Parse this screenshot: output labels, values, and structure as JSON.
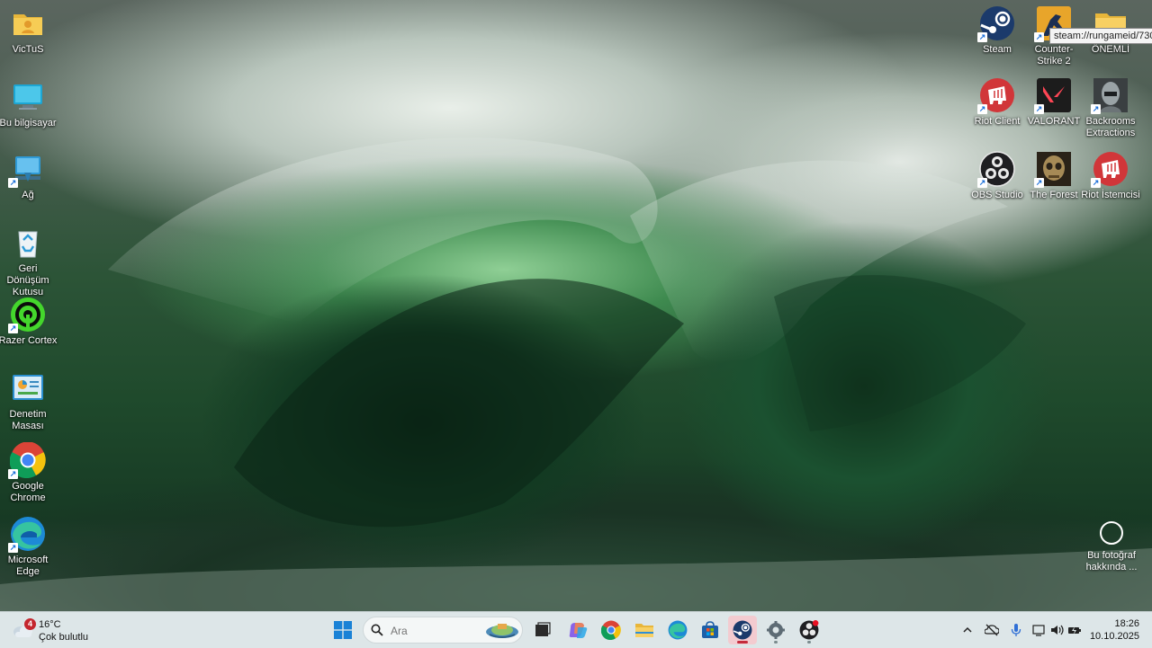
{
  "desktop": {
    "left_icons": [
      {
        "label": "VicTuS",
        "icon": "user-folder-icon"
      },
      {
        "label": "Bu bilgisayar",
        "icon": "monitor-icon"
      },
      {
        "label": "Ağ",
        "icon": "network-icon"
      },
      {
        "label": "Geri Dönüşüm Kutusu",
        "icon": "recycle-bin-icon"
      },
      {
        "label": "Razer Cortex",
        "icon": "razer-cortex-icon"
      },
      {
        "label": "Denetim Masası",
        "icon": "control-panel-icon"
      },
      {
        "label": "Google Chrome",
        "icon": "chrome-icon"
      },
      {
        "label": "Microsoft Edge",
        "icon": "edge-icon"
      }
    ],
    "right_icons": [
      {
        "label": "Steam",
        "icon": "steam-icon"
      },
      {
        "label": "Counter-Strike 2",
        "icon": "counter-strike-icon"
      },
      {
        "label": "ÖNEMLİ",
        "icon": "folder-icon"
      },
      {
        "label": "Riot Client",
        "icon": "riot-client-icon"
      },
      {
        "label": "VALORANT",
        "icon": "valorant-icon"
      },
      {
        "label": "Backrooms Extractions",
        "icon": "backrooms-icon"
      },
      {
        "label": "OBS Studio",
        "icon": "obs-icon"
      },
      {
        "label": "The Forest",
        "icon": "the-forest-icon"
      },
      {
        "label": "Riot İstemcisi",
        "icon": "riot-istemcisi-icon"
      }
    ],
    "tooltip": "steam://rungameid/730",
    "about_photo": {
      "line1": "Bu fotoğraf",
      "line2": "hakkında ..."
    }
  },
  "taskbar": {
    "weather": {
      "badge": "4",
      "temp": "16°C",
      "desc": "Çok bulutlu"
    },
    "search_placeholder": "Ara",
    "apps": [
      "start-icon",
      "search",
      "task-view-icon",
      "copilot-icon",
      "chrome-icon",
      "file-explorer-icon",
      "edge-icon",
      "store-icon",
      "steam-icon",
      "settings-icon",
      "obs-icon"
    ],
    "active_app": "steam",
    "clock": {
      "time": "18:26",
      "date": "10.10.2025"
    }
  },
  "colors": {
    "taskbar_bg": "#dde6e8",
    "active_indicator": "#c42b3c",
    "riot_red": "#d13639"
  }
}
